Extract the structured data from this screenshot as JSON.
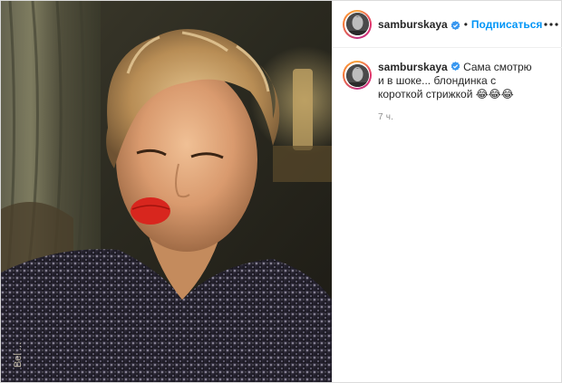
{
  "post": {
    "username": "samburskaya",
    "follow_label": "Подписаться",
    "separator": "•",
    "caption": "Сама смотрю и в шоке... блондинка с короткой стрижкой 😂😂😂",
    "time_ago": "7 ч.",
    "photo_overlay_text": "Bel ...",
    "verified_color": "#3897f0",
    "follow_color": "#0095f6"
  },
  "icons": {
    "verified": "verified-badge-icon",
    "more": "more-options-icon"
  }
}
